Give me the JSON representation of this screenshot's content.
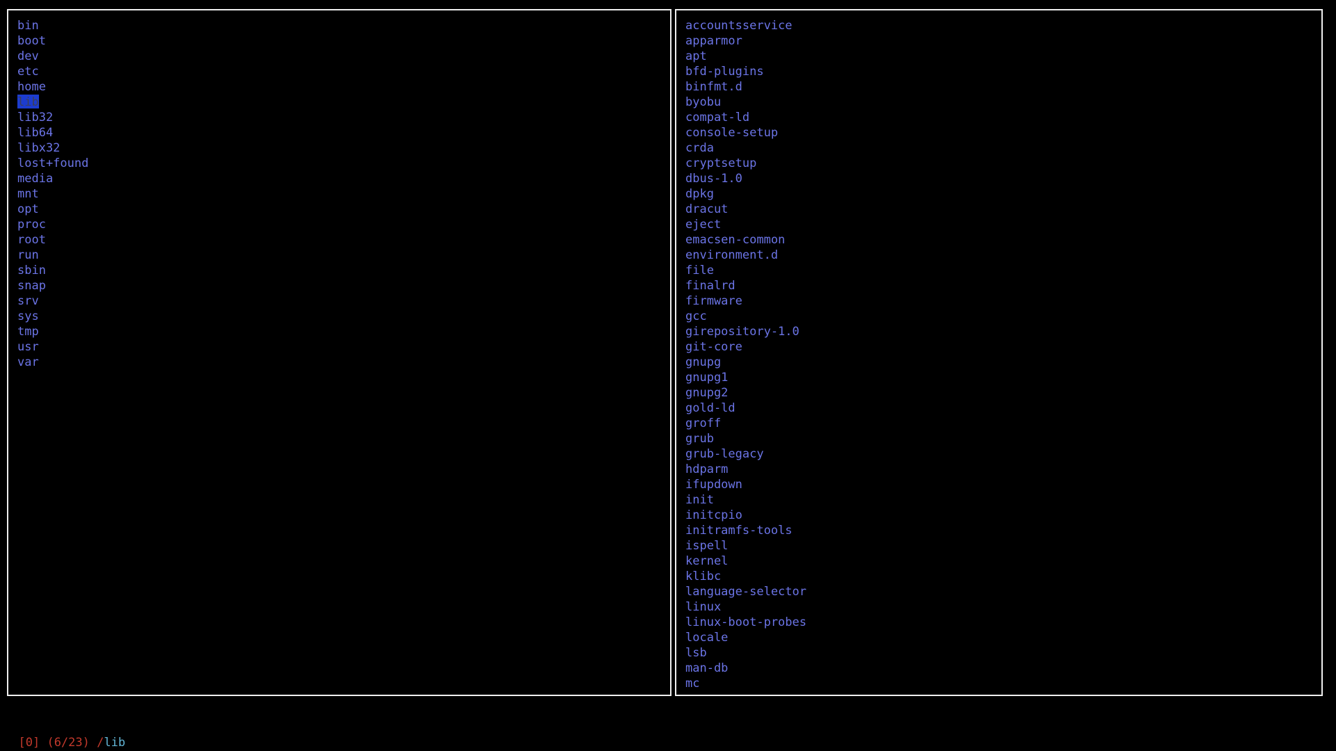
{
  "left_pane": {
    "items": [
      "bin",
      "boot",
      "dev",
      "etc",
      "home",
      "lib",
      "lib32",
      "lib64",
      "libx32",
      "lost+found",
      "media",
      "mnt",
      "opt",
      "proc",
      "root",
      "run",
      "sbin",
      "snap",
      "srv",
      "sys",
      "tmp",
      "usr",
      "var"
    ],
    "selected_index": 5
  },
  "right_pane": {
    "items": [
      "accountsservice",
      "apparmor",
      "apt",
      "bfd-plugins",
      "binfmt.d",
      "byobu",
      "compat-ld",
      "console-setup",
      "crda",
      "cryptsetup",
      "dbus-1.0",
      "dpkg",
      "dracut",
      "eject",
      "emacsen-common",
      "environment.d",
      "file",
      "finalrd",
      "firmware",
      "gcc",
      "girepository-1.0",
      "git-core",
      "gnupg",
      "gnupg1",
      "gnupg2",
      "gold-ld",
      "groff",
      "grub",
      "grub-legacy",
      "hdparm",
      "ifupdown",
      "init",
      "initcpio",
      "initramfs-tools",
      "ispell",
      "kernel",
      "klibc",
      "language-selector",
      "linux",
      "linux-boot-probes",
      "locale",
      "lsb",
      "man-db",
      "mc"
    ]
  },
  "statusline": {
    "tab_index": "[0]",
    "position": "(6/23)",
    "path_prefix": "/",
    "path_current": "lib"
  },
  "colors": {
    "entry_text": "#6b74e6",
    "selection_bg": "#1c3ccf",
    "status_red": "#c3392c",
    "status_cyan": "#62b6d6",
    "border": "#f0f0f0"
  }
}
